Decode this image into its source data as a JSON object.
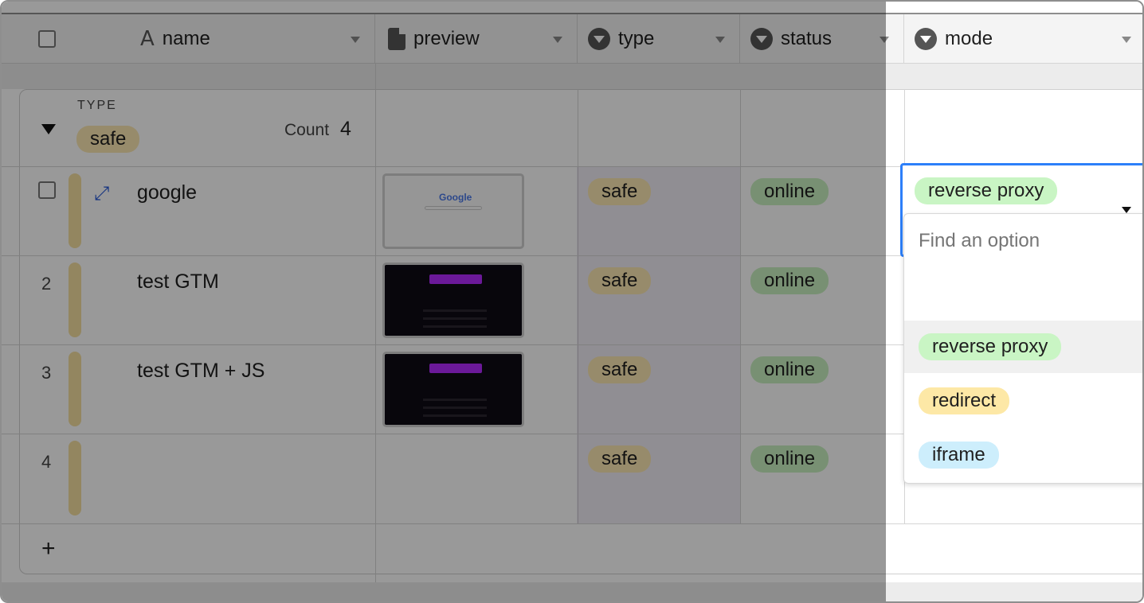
{
  "columns": [
    {
      "label": "name",
      "icon": "text-field-icon"
    },
    {
      "label": "preview",
      "icon": "document-icon"
    },
    {
      "label": "type",
      "icon": "single-select-icon"
    },
    {
      "label": "status",
      "icon": "single-select-icon"
    },
    {
      "label": "mode",
      "icon": "single-select-icon"
    }
  ],
  "group": {
    "field_label": "TYPE",
    "value": "safe",
    "count_label": "Count",
    "count": "4"
  },
  "rows": [
    {
      "index": "",
      "name": "google",
      "preview": "light",
      "type": "safe",
      "status": "online"
    },
    {
      "index": "2",
      "name": "test GTM",
      "preview": "dark",
      "type": "safe",
      "status": "online"
    },
    {
      "index": "3",
      "name": "test GTM + JS",
      "preview": "dark",
      "type": "safe",
      "status": "online"
    },
    {
      "index": "4",
      "name": "",
      "preview": "",
      "type": "safe",
      "status": "online"
    }
  ],
  "thumbnails": {
    "google_logo": "Google"
  },
  "add_row": "+",
  "mode_cell": {
    "value": "reverse proxy"
  },
  "dropdown": {
    "search_placeholder": "Find an option",
    "options": [
      {
        "label": "reverse proxy",
        "color": "#c9f5c4"
      },
      {
        "label": "redirect",
        "color": "#fde8a6"
      },
      {
        "label": "iframe",
        "color": "#cdeefc"
      }
    ]
  },
  "colors": {
    "accent": "#2d7ff9",
    "safe_pill": "#fce8b2",
    "online_pill": "#c8f0c0"
  }
}
